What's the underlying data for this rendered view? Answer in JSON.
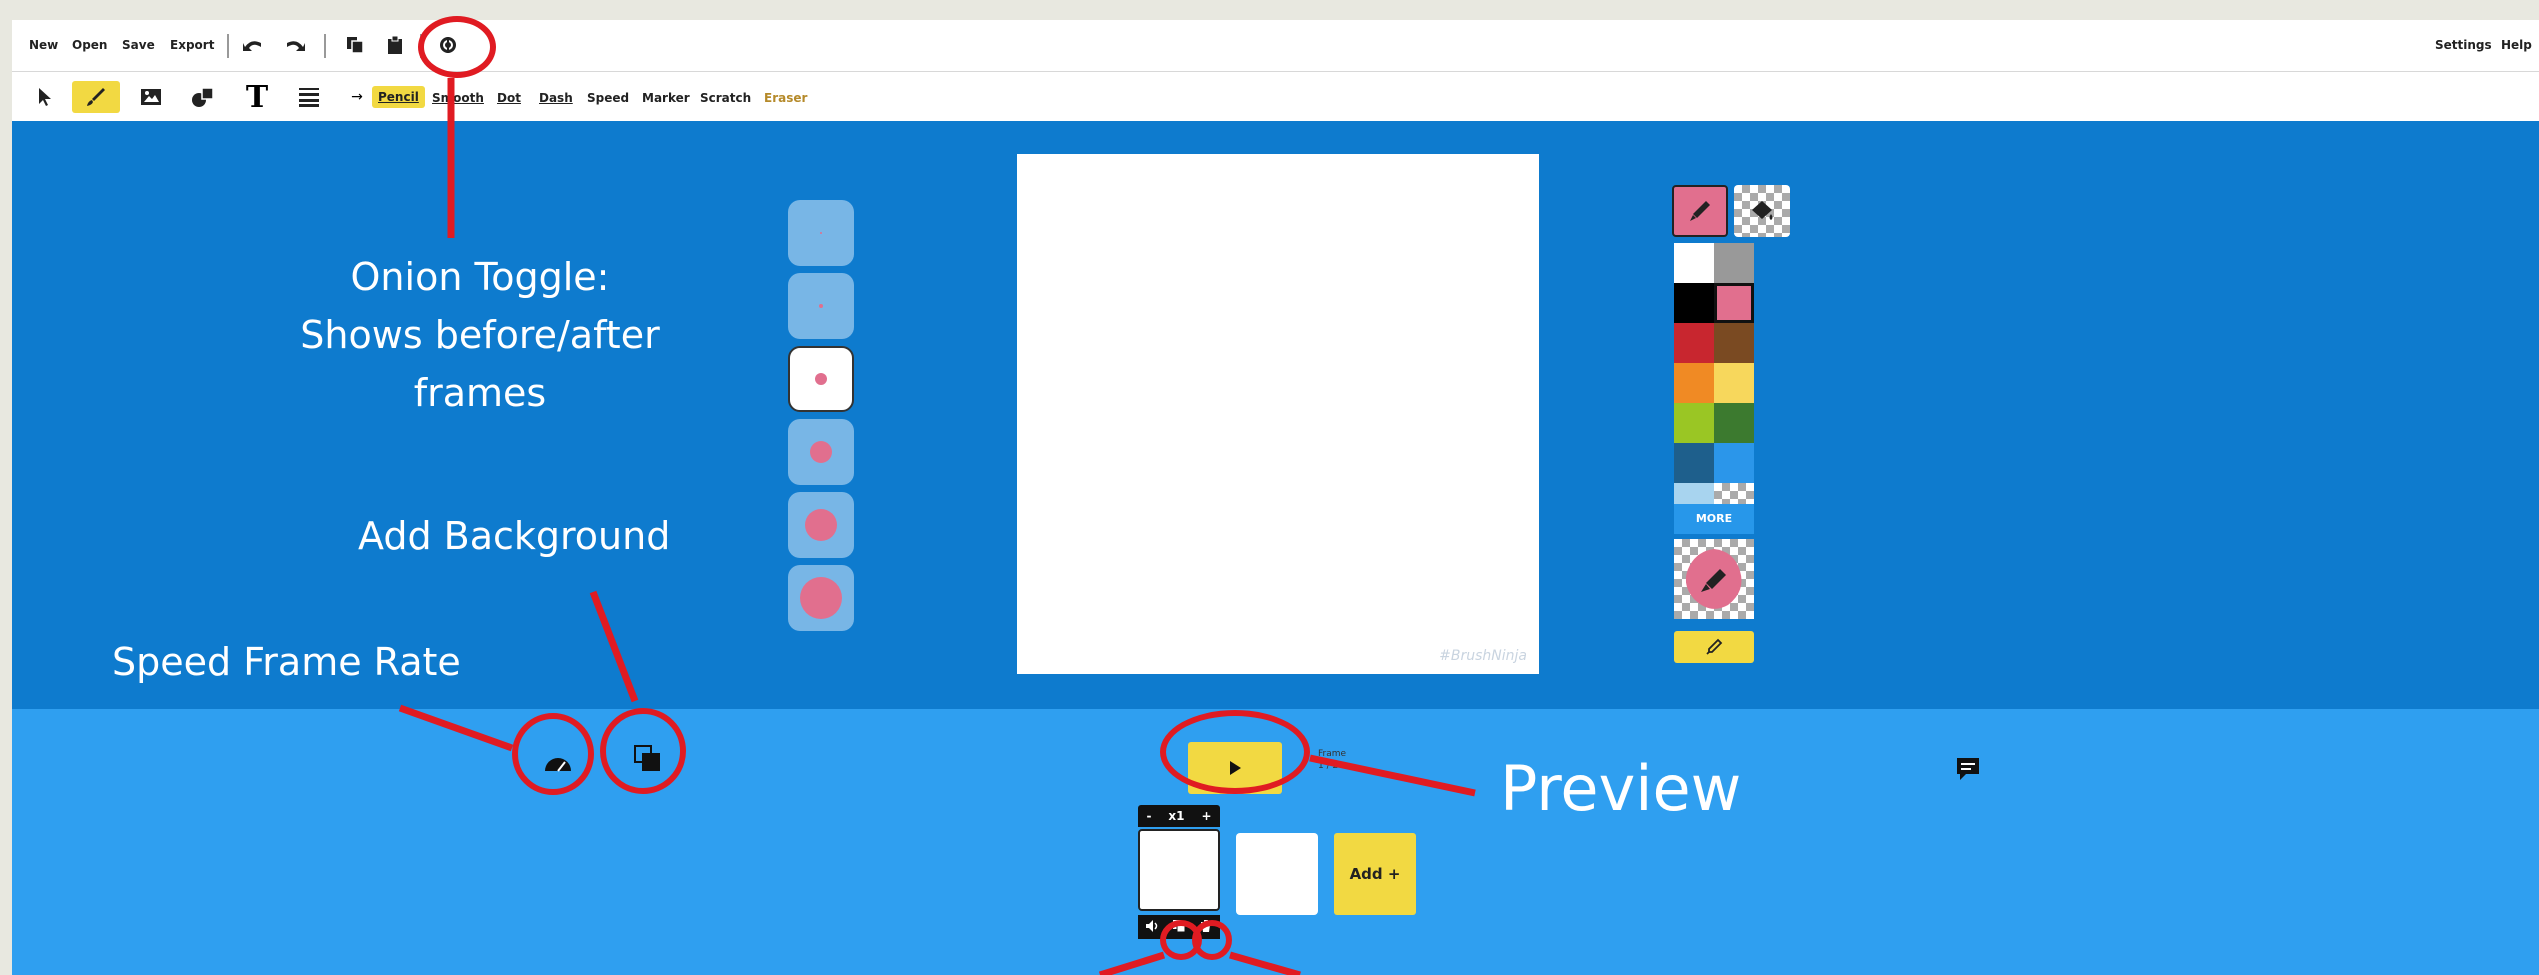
{
  "menu": {
    "new": "New",
    "open": "Open",
    "save": "Save",
    "export": "Export",
    "settings": "Settings",
    "help": "Help"
  },
  "brushes": [
    "Pencil",
    "Smooth",
    "Dot",
    "Dash",
    "Speed",
    "Marker",
    "Scratch",
    "Eraser"
  ],
  "palette": {
    "more_label": "MORE",
    "colors": {
      "white": "#ffffff",
      "grey": "#999999",
      "black": "#000000",
      "pink": "#e16f8e",
      "red": "#c8262f",
      "brown": "#7a4a22",
      "orange": "#f08a24",
      "yellow": "#f7d75c",
      "lime": "#9ac624",
      "green": "#3c7a2f",
      "navy": "#1e5f8c",
      "sky": "#2b96ea",
      "light_blue": "#a8d4ef"
    }
  },
  "canvas": {
    "watermark": "#BrushNinja"
  },
  "timeline": {
    "frame_label": "Frame",
    "frame_count": "1 / 2",
    "speed_minus": "-",
    "speed_value": "x1",
    "speed_plus": "+",
    "add_label": "Add +"
  },
  "annotations": {
    "onion_line1": "Onion Toggle:",
    "onion_line2": "Shows before/after",
    "onion_line3": "frames",
    "add_background": "Add Background",
    "speed_frame_rate": "Speed Frame Rate",
    "preview": "Preview"
  },
  "theme": {
    "work_bg": "#0e7bce",
    "bottom_bg": "#2f9ff0",
    "accent_yellow": "#f2d942",
    "annotation_red": "#e01b22"
  }
}
